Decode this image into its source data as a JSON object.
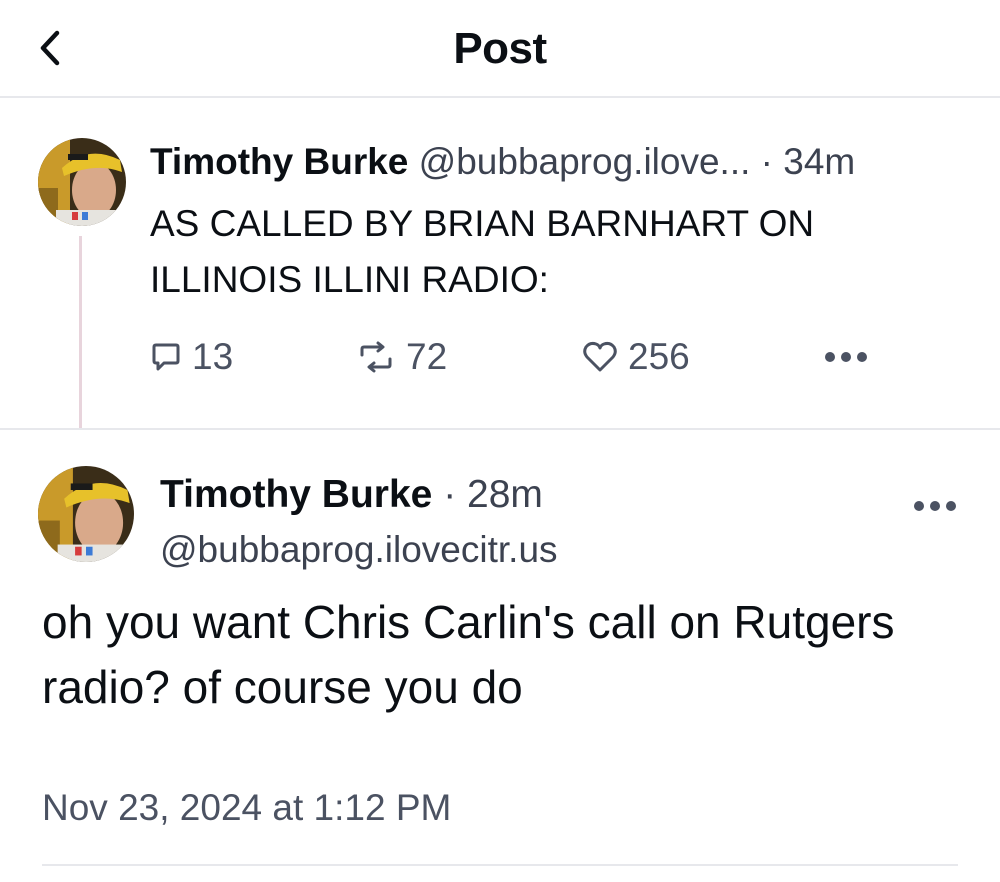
{
  "header": {
    "title": "Post"
  },
  "parent_post": {
    "author_name": "Timothy Burke",
    "handle": "@bubbaprog.ilove...",
    "separator": "·",
    "time": "34m",
    "text": "AS CALLED BY BRIAN BARNHART ON ILLINOIS ILLINI RADIO:",
    "replies": "13",
    "reposts": "72",
    "likes": "256"
  },
  "main_post": {
    "author_name": "Timothy Burke",
    "separator": "·",
    "time": "28m",
    "handle": "@bubbaprog.ilovecitr.us",
    "text": "oh you want Chris Carlin's call on Rutgers radio? of course you do",
    "timestamp": "Nov 23, 2024 at 1:12 PM"
  },
  "icons": {
    "back": "chevron-left-icon",
    "reply": "speech-bubble-icon",
    "repost": "repost-arrows-icon",
    "like": "heart-icon",
    "more": "ellipsis-icon"
  },
  "colors": {
    "text": "#0b0f14",
    "secondary": "#4b5262",
    "divider": "#e7e8ec",
    "thread_line": "#e8d4dc"
  }
}
